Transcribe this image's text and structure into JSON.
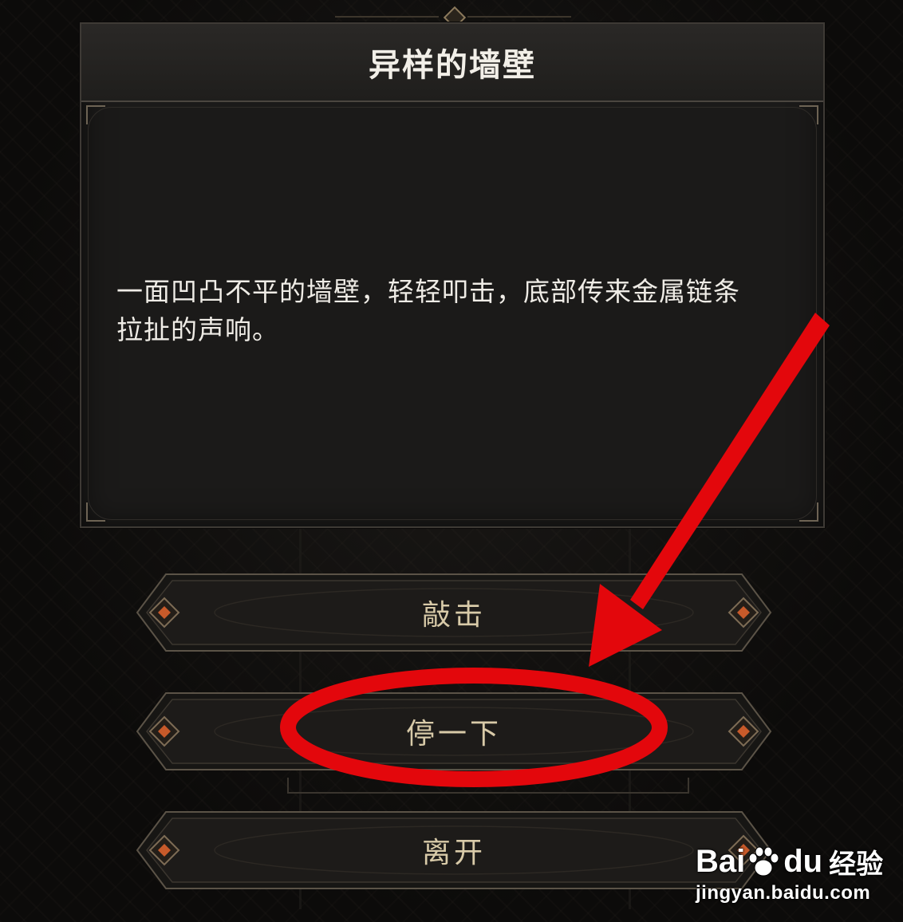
{
  "event": {
    "title": "异样的墙壁",
    "description_line1": "一面凹凸不平的墙壁，轻轻叩击，底部传来金属链条",
    "description_line2": "拉扯的声响。"
  },
  "choices": [
    {
      "label": "敲击"
    },
    {
      "label": "停一下",
      "highlighted": true
    },
    {
      "label": "离开"
    }
  ],
  "annotation": {
    "color": "#e3070c",
    "shapes": [
      "arrow",
      "ellipse-highlight"
    ]
  },
  "watermark": {
    "brand_bai": "Bai",
    "brand_du": "du",
    "brand_jingyan": "经验",
    "url": "jingyan.baidu.com",
    "icon": "paw-icon"
  },
  "colors": {
    "panel_bg": "#1b1a19",
    "title_text": "#f2efe8",
    "choice_text": "#d8caa8",
    "gem": "#c85a2a"
  }
}
